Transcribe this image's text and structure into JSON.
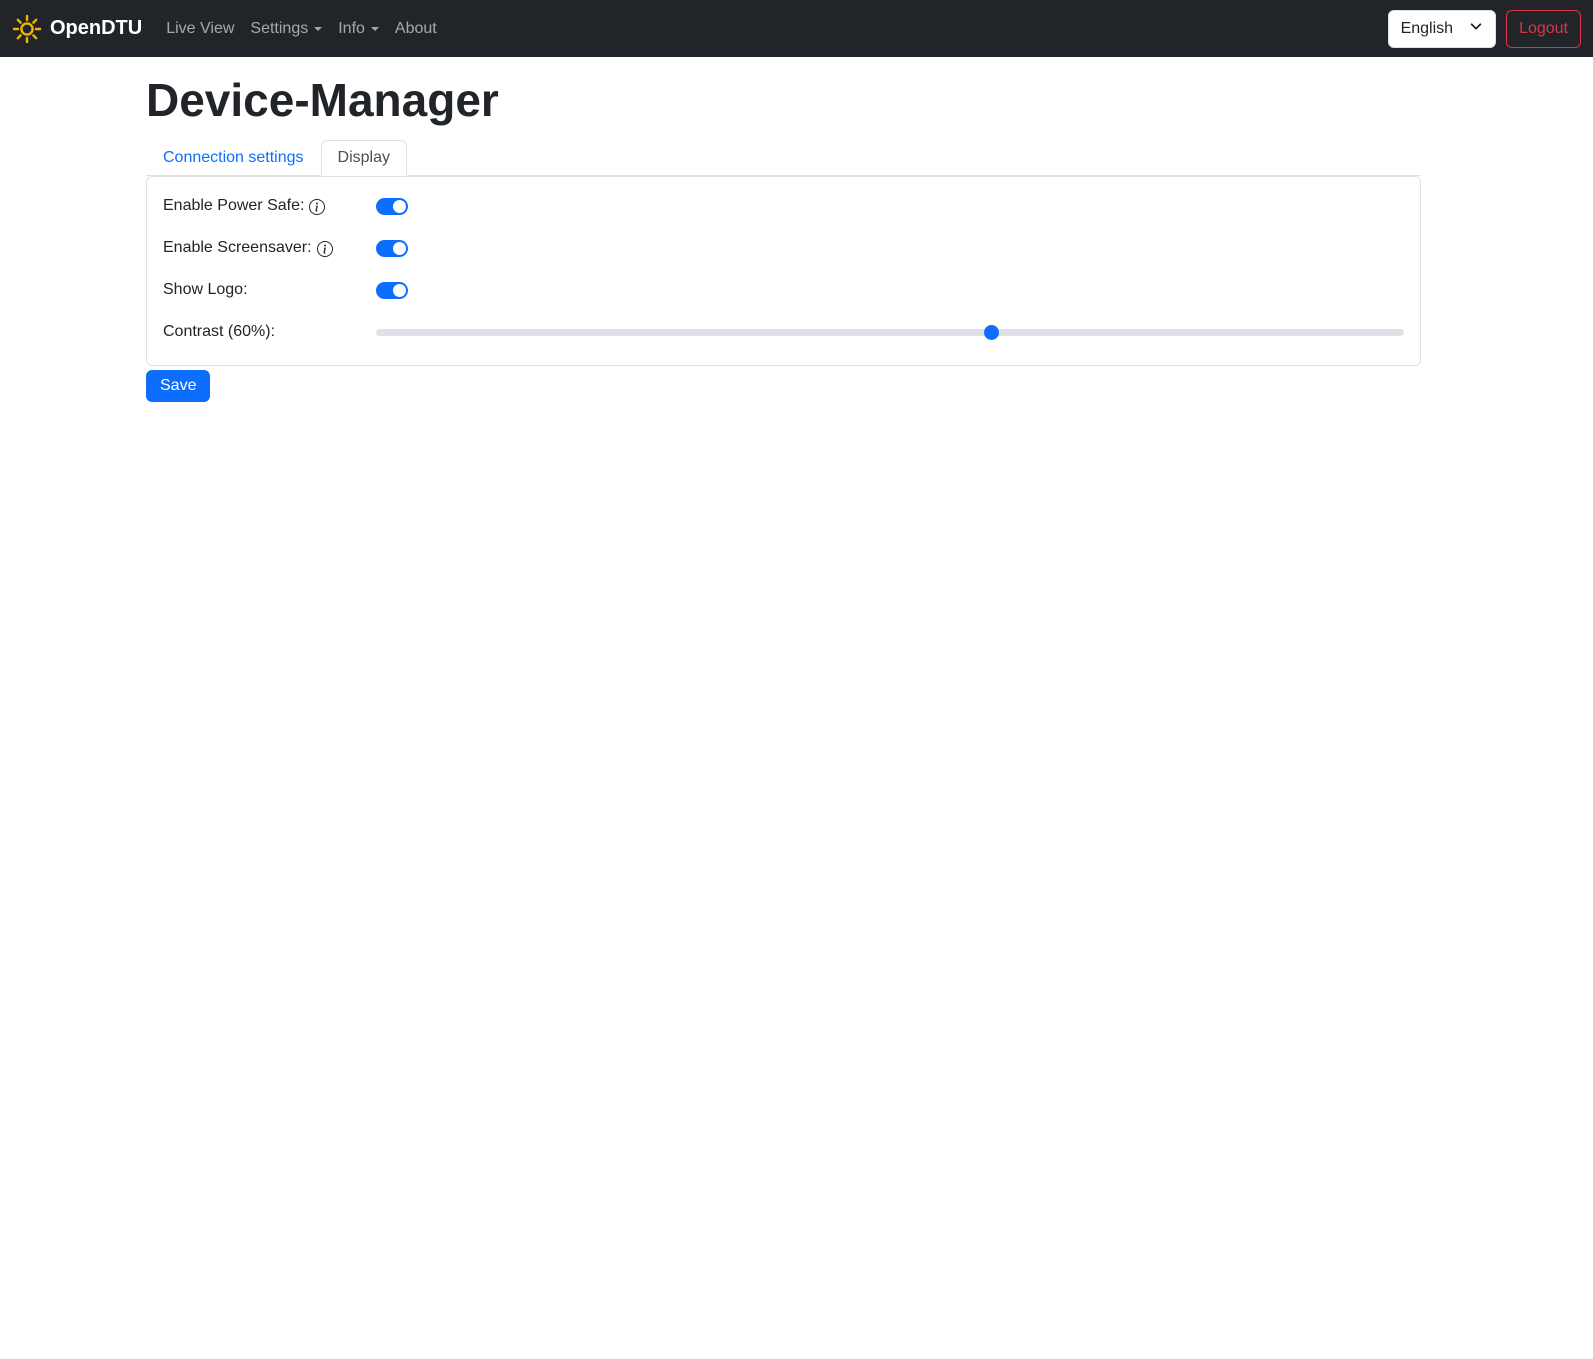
{
  "navbar": {
    "brand": "OpenDTU",
    "items": [
      {
        "label": "Live View",
        "dropdown": false
      },
      {
        "label": "Settings",
        "dropdown": true
      },
      {
        "label": "Info",
        "dropdown": true
      },
      {
        "label": "About",
        "dropdown": false
      }
    ],
    "language": {
      "selected": "English"
    },
    "logout_label": "Logout"
  },
  "page": {
    "title": "Device-Manager"
  },
  "tabs": [
    {
      "label": "Connection settings",
      "active": false
    },
    {
      "label": "Display",
      "active": true
    }
  ],
  "form": {
    "rows": [
      {
        "label": "Enable Power Safe:",
        "type": "switch",
        "checked": true,
        "has_info": true
      },
      {
        "label": "Enable Screensaver:",
        "type": "switch",
        "checked": true,
        "has_info": true
      },
      {
        "label": "Show Logo:",
        "type": "switch",
        "checked": true,
        "has_info": false
      },
      {
        "label": "Contrast (60%):",
        "type": "range",
        "value": 60,
        "min": 0,
        "max": 100
      }
    ],
    "save_label": "Save"
  },
  "colors": {
    "accent": "#0d6efd",
    "navbar_bg": "#212529",
    "danger": "#dc3545",
    "brand_icon": "#f0b400",
    "track": "#dee2e6"
  }
}
